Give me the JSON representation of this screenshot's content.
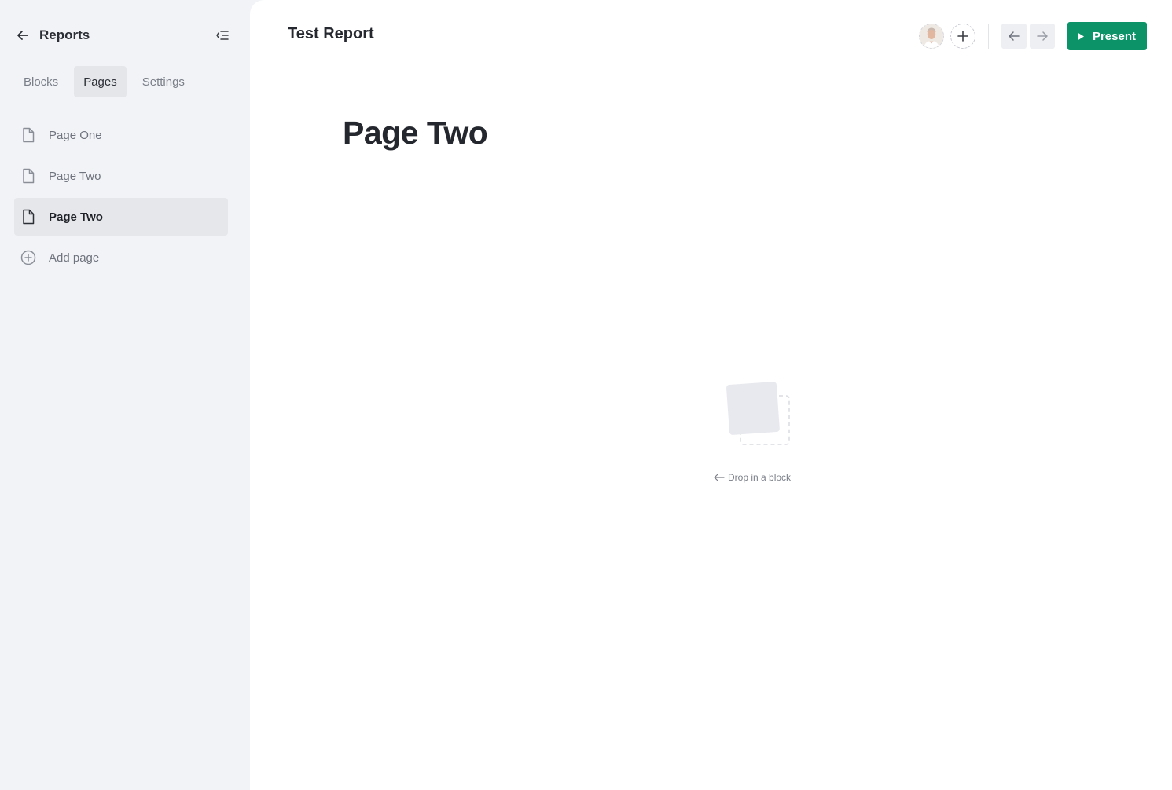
{
  "sidebar": {
    "title": "Reports",
    "tabs": [
      {
        "label": "Blocks"
      },
      {
        "label": "Pages"
      },
      {
        "label": "Settings"
      }
    ],
    "pages": [
      {
        "label": "Page One"
      },
      {
        "label": "Page Two"
      },
      {
        "label": "Page Two"
      }
    ],
    "add_page_label": "Add page"
  },
  "main": {
    "report_title": "Test Report",
    "page_heading": "Page Two",
    "present_label": "Present",
    "drop_hint": "Drop in a block"
  },
  "colors": {
    "accent": "#0c9468",
    "sidebar_bg": "#f2f3f7",
    "active_item_bg": "#e6e7eb"
  }
}
